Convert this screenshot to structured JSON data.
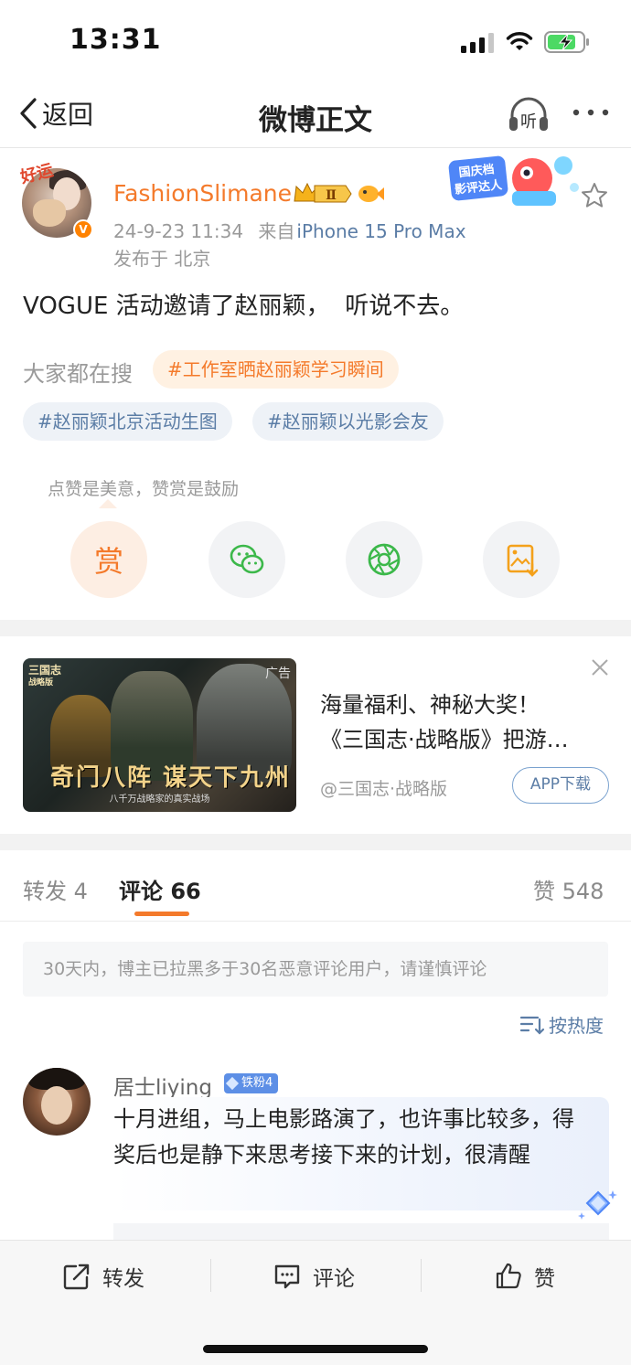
{
  "status_bar": {
    "time": "13:31"
  },
  "nav": {
    "back_label": "返回",
    "title": "微博正文",
    "listen_label": "听"
  },
  "post": {
    "avatar_badge": "好运",
    "username": "FashionSlimane",
    "vip_level": "Ⅱ",
    "event_badge_text": [
      "国庆档",
      "影评达人"
    ],
    "date": "24-9-23 11:34",
    "source_prefix": "来自",
    "source": "iPhone 15 Pro Max",
    "location": "发布于 北京",
    "text": "VOGUE 活动邀请了赵丽颖，  听说不去。",
    "search_label": "大家都在搜",
    "tags": [
      "#工作室晒赵丽颖学习瞬间",
      "#赵丽颖北京活动生图",
      "#赵丽颖以光影会友"
    ],
    "reward_tip": "点赞是美意，赞赏是鼓励",
    "reward_label": "赏"
  },
  "ad": {
    "image_logo": [
      "三国志",
      "战略版"
    ],
    "image_label": "广告",
    "image_slogan": "奇门八阵 谋天下九州",
    "image_subtitle": "八千万战略家的真实战场",
    "title_line1": "海量福利、神秘大奖！",
    "title_line2": "《三国志·战略版》把游…",
    "account": "@三国志·战略版",
    "button_label": "APP下载"
  },
  "tabs": {
    "repost": "转发 4",
    "comment": "评论 66",
    "like": "赞 548"
  },
  "notice": "30天内，博主已拉黑多于30名恶意评论用户，请谨慎评论",
  "sort_label": "按热度",
  "comments": [
    {
      "name": "居士liying",
      "fan_badge": "铁粉4",
      "text": "十月进组，马上电影路演了，也许事比较多，得奖后也是静下来思考接下来的计划，很清醒"
    }
  ],
  "bottom_bar": {
    "repost": "转发",
    "comment": "评论",
    "like": "赞"
  },
  "colors": {
    "accent": "#f47a2b",
    "link": "#5b7da6",
    "fan_badge": "#5d8fe6"
  }
}
